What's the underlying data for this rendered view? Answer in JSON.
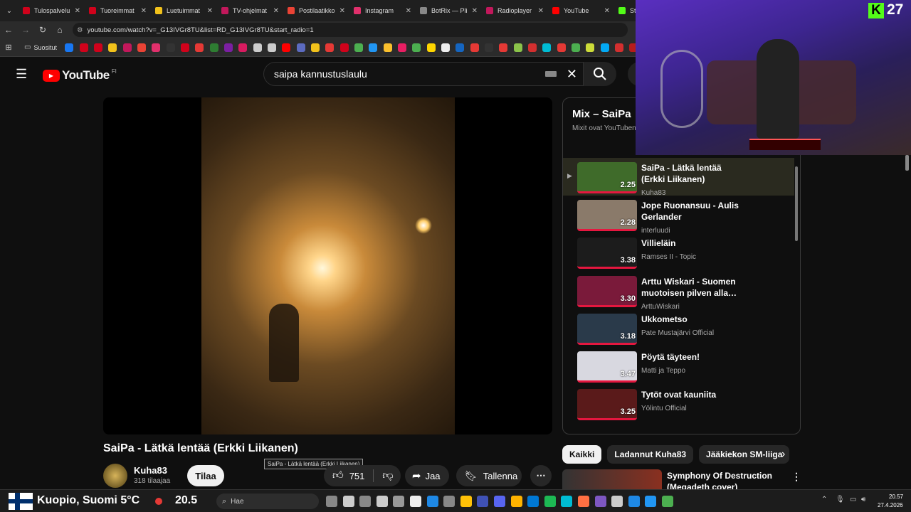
{
  "tabs": [
    {
      "label": "Tulospalvelu",
      "color": "#d0021b"
    },
    {
      "label": "Tuoreimmat",
      "color": "#d0021b"
    },
    {
      "label": "Luetuimmat",
      "color": "#f2c21b"
    },
    {
      "label": "TV-ohjelmat",
      "color": "#c2185b"
    },
    {
      "label": "Postilaatikko",
      "color": "#ea4335"
    },
    {
      "label": "Instagram",
      "color": "#e1306c"
    },
    {
      "label": "BotRix — Pli",
      "color": "#888888"
    },
    {
      "label": "Radioplayer",
      "color": "#c2185b"
    },
    {
      "label": "YouTube",
      "color": "#ff0000"
    },
    {
      "label": "Stre",
      "color": "#53fc18"
    }
  ],
  "address": {
    "url": "youtube.com/watch?v=_G13IVGr8TU&list=RD_G13IVGr8TU&start_radio=1"
  },
  "bookmarks": {
    "folder_label": "Suositut"
  },
  "youtube": {
    "logo_text": "YouTube",
    "region": "FI",
    "search_value": "saipa kannustuslaulu"
  },
  "video": {
    "title": "SaiPa - Lätkä lentää (Erkki Liikanen)",
    "tooltip": "SaiPa - Lätkä lentää (Erkki Liikanen)",
    "channel": "Kuha83",
    "subscribers": "318 tilaajaa",
    "subscribe_label": "Tilaa",
    "likes": "751",
    "share_label": "Jaa",
    "save_label": "Tallenna"
  },
  "mix": {
    "title": "Mix – SaiPa",
    "subtitle": "Mixit ovat YouTuben",
    "items": [
      {
        "title": "SaiPa - Lätkä lentää (Erkki Liikanen)",
        "channel": "Kuha83",
        "duration": "2.25",
        "thumb": "#3f6b2a",
        "active": true
      },
      {
        "title": "Jope Ruonansuu - Aulis Gerlander",
        "channel": "interluudi",
        "duration": "2.28",
        "thumb": "#8a7a6a",
        "active": false
      },
      {
        "title": "Villieläin",
        "channel": "Ramses II - Topic",
        "duration": "3.38",
        "thumb": "#1c1c1c",
        "active": false
      },
      {
        "title": "Arttu Wiskari - Suomen muotoisen pilven alla…",
        "channel": "ArttuWiskari",
        "duration": "3.30",
        "thumb": "#7a1a3a",
        "active": false
      },
      {
        "title": "Ukkometso",
        "channel": "Pate Mustajärvi Official",
        "duration": "3.18",
        "thumb": "#2a3a4a",
        "active": false
      },
      {
        "title": "Pöytä täyteen!",
        "channel": "Matti ja Teppo",
        "duration": "3.47",
        "thumb": "#d8d8e0",
        "active": false
      },
      {
        "title": "Tytöt ovat kauniita",
        "channel": "Yölintu Official",
        "duration": "3.25",
        "thumb": "#5a1a1a",
        "active": false
      }
    ]
  },
  "chips": [
    "Kaikki",
    "Ladannut Kuha83",
    "Jääkiekon SM-liiga"
  ],
  "related": {
    "title": "Symphony Of Destruction (Megadeth cover)"
  },
  "overlay": {
    "counter": "27"
  },
  "taskbar": {
    "weather": "Kuopio, Suomi 5°C",
    "temp2": "20.5",
    "search_placeholder": "Hae",
    "time": "20.57",
    "date": "27.4.2026"
  }
}
